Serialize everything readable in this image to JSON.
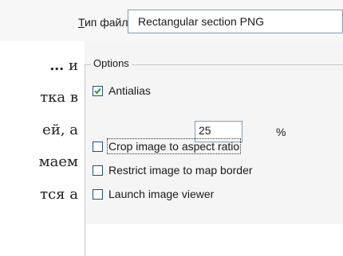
{
  "file_type": {
    "label_mnemonic": "Т",
    "label_rest": "ип файла:",
    "value": "Rectangular section PNG"
  },
  "background_text": {
    "line1_bold": "…",
    "line1_rest": " и",
    "line2": "тка в",
    "line3": "ей, а",
    "line4": "маем",
    "line5": "тся а"
  },
  "options": {
    "legend": "Options",
    "antialias": {
      "label": "Antialias",
      "checked": true,
      "value": "25",
      "unit": "%"
    },
    "crop": {
      "label": "Crop image to aspect ratio",
      "checked": false
    },
    "restrict": {
      "label": "Restrict image to map border",
      "checked": false
    },
    "launch": {
      "label": "Launch image viewer",
      "checked": false
    }
  }
}
